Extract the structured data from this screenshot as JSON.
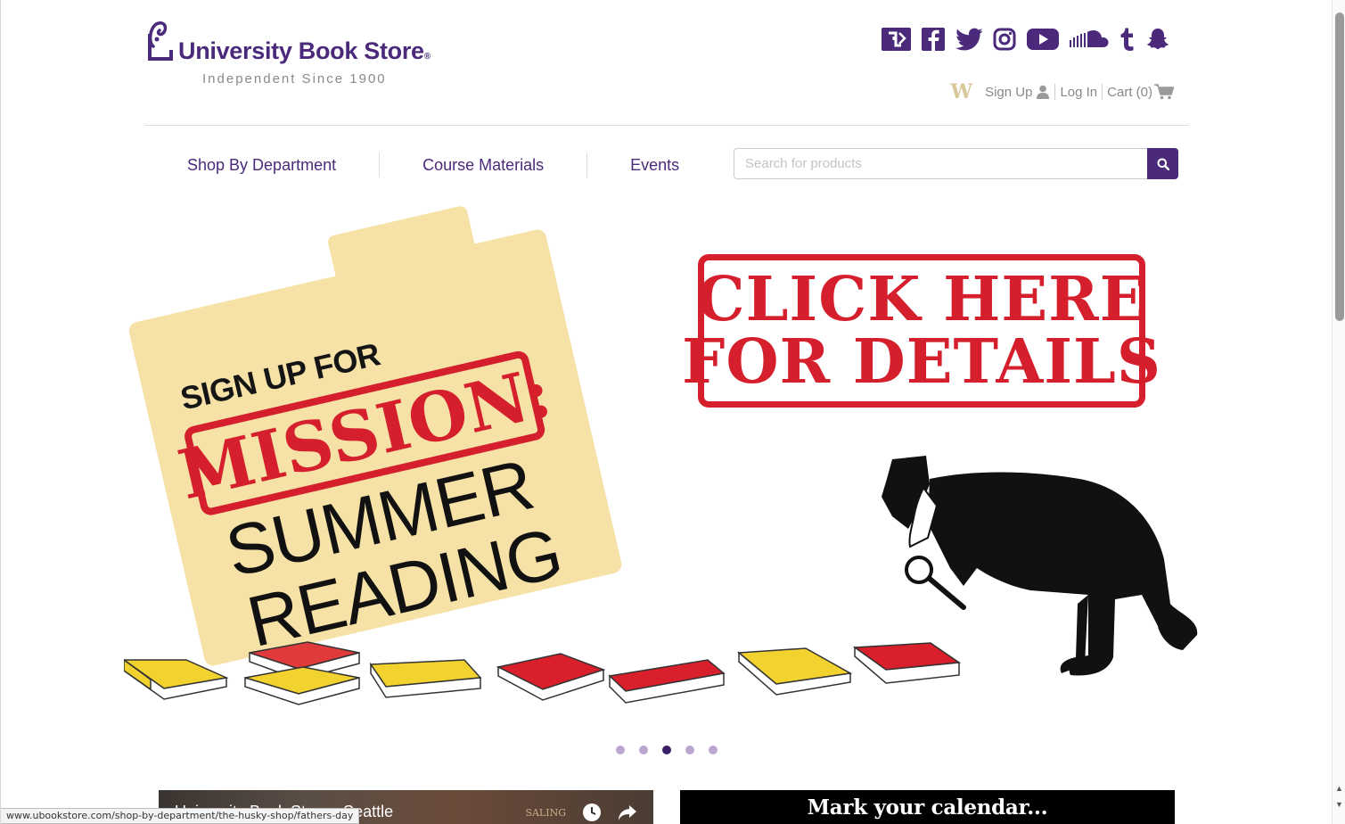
{
  "brand": {
    "name": "University Book Store",
    "registered": "®",
    "tagline": "Independent Since 1900",
    "purple": "#4b2a7b"
  },
  "social_icons": [
    "ubs-icon",
    "facebook-icon",
    "twitter-icon",
    "instagram-icon",
    "youtube-icon",
    "soundcloud-icon",
    "tumblr-icon",
    "snapchat-icon"
  ],
  "account": {
    "husky_letter": "W",
    "sign_up": "Sign Up",
    "log_in": "Log In",
    "cart": "Cart (0)"
  },
  "nav": {
    "items": [
      "Shop By Department",
      "Course Materials",
      "Events"
    ]
  },
  "search": {
    "placeholder": "Search for products"
  },
  "hero": {
    "signup": "SIGN UP FOR",
    "mission": "MISSION:",
    "summer": "SUMMER",
    "reading": "READING",
    "cta_line1": "CLICK HERE",
    "cta_line2": "FOR DETAILS",
    "red": "#d51f2d",
    "folder_color": "#f6e2a7",
    "slides_total": 5,
    "active_slide": 3
  },
  "video": {
    "title": "University Book Store - Seattle",
    "watermark": "SALING"
  },
  "calendar": {
    "title": "Mark your calendar..."
  },
  "status_url": "www.ubookstore.com/shop-by-department/the-husky-shop/fathers-day"
}
